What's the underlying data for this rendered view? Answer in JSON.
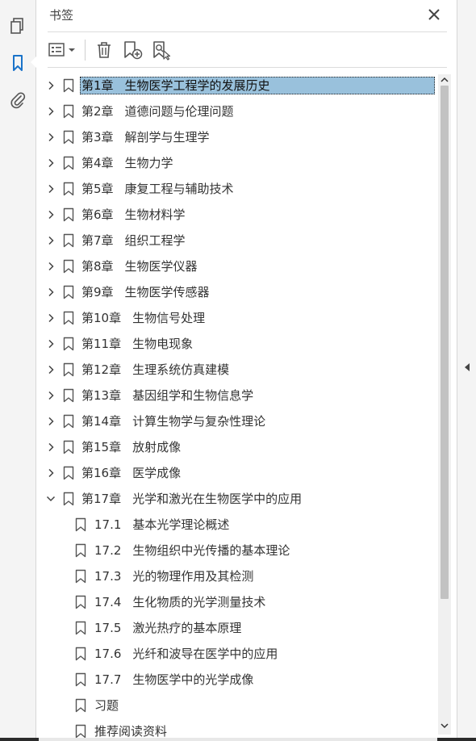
{
  "panel": {
    "title": "书签"
  },
  "icons": {
    "pages": "pages-icon",
    "bookmarks": "bookmark-panel-icon",
    "attachments": "attachment-icon"
  },
  "colors": {
    "selected_bg": "#99c1dc",
    "icon_blue": "#1a73c9"
  },
  "bookmarks": [
    {
      "num": "第1章",
      "title": "生物医学工程学的发展历史",
      "level": 0,
      "state": "collapsed",
      "selected": true
    },
    {
      "num": "第2章",
      "title": "道德问题与伦理问题",
      "level": 0,
      "state": "collapsed"
    },
    {
      "num": "第3章",
      "title": "解剖学与生理学",
      "level": 0,
      "state": "collapsed"
    },
    {
      "num": "第4章",
      "title": "生物力学",
      "level": 0,
      "state": "collapsed"
    },
    {
      "num": "第5章",
      "title": "康复工程与辅助技术",
      "level": 0,
      "state": "collapsed"
    },
    {
      "num": "第6章",
      "title": "生物材料学",
      "level": 0,
      "state": "collapsed"
    },
    {
      "num": "第7章",
      "title": "组织工程学",
      "level": 0,
      "state": "collapsed"
    },
    {
      "num": "第8章",
      "title": "生物医学仪器",
      "level": 0,
      "state": "collapsed"
    },
    {
      "num": "第9章",
      "title": "生物医学传感器",
      "level": 0,
      "state": "collapsed"
    },
    {
      "num": "第10章",
      "title": "生物信号处理",
      "level": 0,
      "state": "collapsed"
    },
    {
      "num": "第11章",
      "title": "生物电现象",
      "level": 0,
      "state": "collapsed"
    },
    {
      "num": "第12章",
      "title": "生理系统仿真建模",
      "level": 0,
      "state": "collapsed"
    },
    {
      "num": "第13章",
      "title": "基因组学和生物信息学",
      "level": 0,
      "state": "collapsed"
    },
    {
      "num": "第14章",
      "title": "计算生物学与复杂性理论",
      "level": 0,
      "state": "collapsed"
    },
    {
      "num": "第15章",
      "title": "放射成像",
      "level": 0,
      "state": "collapsed"
    },
    {
      "num": "第16章",
      "title": "医学成像",
      "level": 0,
      "state": "collapsed"
    },
    {
      "num": "第17章",
      "title": "光学和激光在生物医学中的应用",
      "level": 0,
      "state": "expanded"
    },
    {
      "num": "17.1",
      "title": "基本光学理论概述",
      "level": 1,
      "state": "leaf"
    },
    {
      "num": "17.2",
      "title": "生物组织中光传播的基本理论",
      "level": 1,
      "state": "leaf"
    },
    {
      "num": "17.3",
      "title": "光的物理作用及其检测",
      "level": 1,
      "state": "leaf"
    },
    {
      "num": "17.4",
      "title": "生化物质的光学测量技术",
      "level": 1,
      "state": "leaf"
    },
    {
      "num": "17.5",
      "title": "激光热疗的基本原理",
      "level": 1,
      "state": "leaf"
    },
    {
      "num": "17.6",
      "title": "光纤和波导在医学中的应用",
      "level": 1,
      "state": "leaf"
    },
    {
      "num": "17.7",
      "title": "生物医学中的光学成像",
      "level": 1,
      "state": "leaf"
    },
    {
      "num": "",
      "title": "习题",
      "level": 1,
      "state": "leaf"
    },
    {
      "num": "",
      "title": "推荐阅读资料",
      "level": 1,
      "state": "leaf"
    }
  ]
}
